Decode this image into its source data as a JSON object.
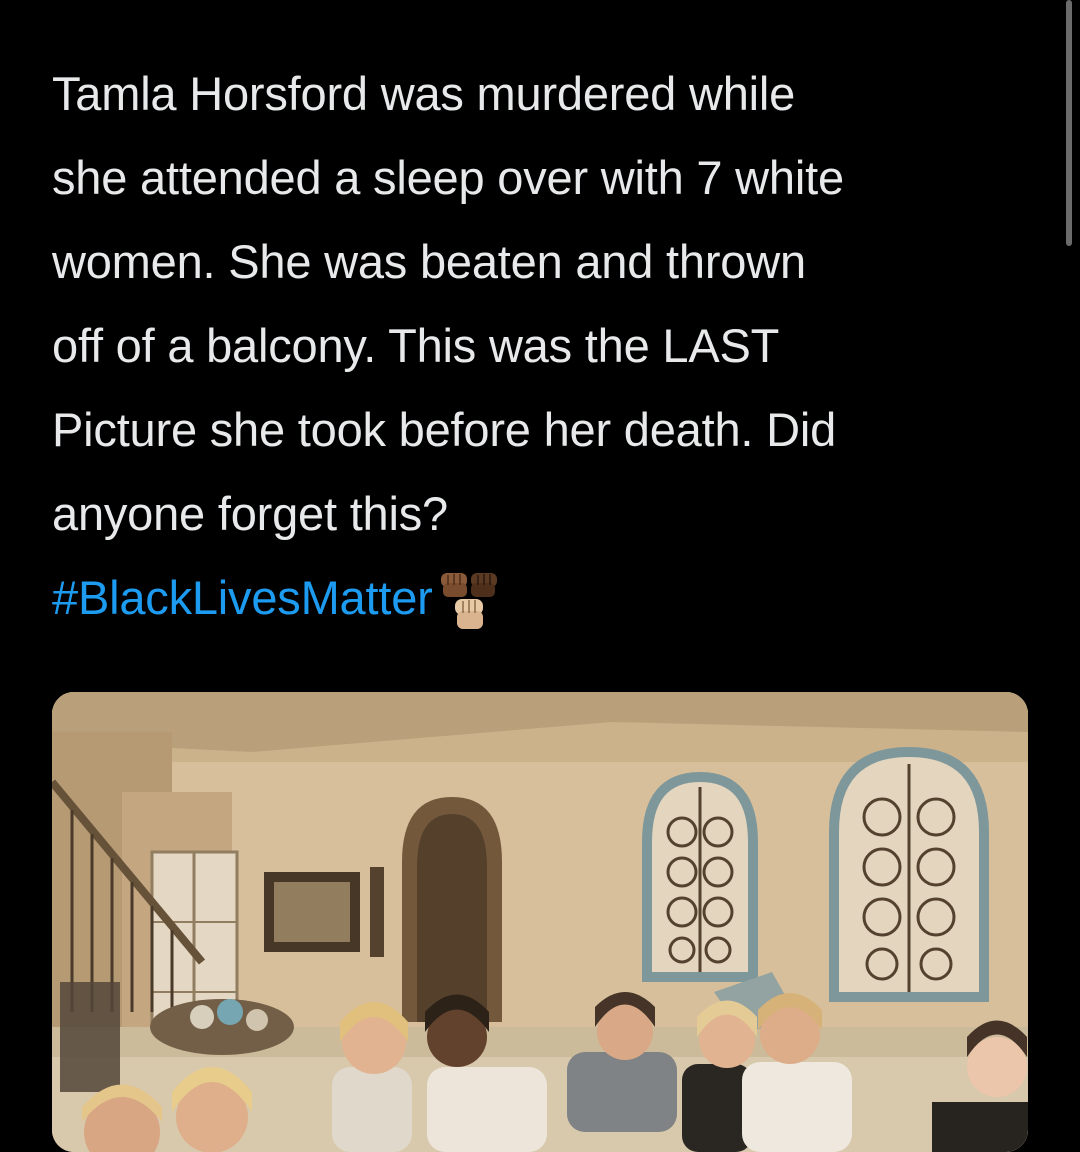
{
  "tweet": {
    "lines": [
      "Tamla Horsford was murdered while",
      "she attended a sleep over with 7 white",
      "women. She was beaten and thrown",
      "off of a balcony. This was the LAST",
      "Picture she took before her death. Did",
      "anyone forget this?"
    ],
    "hashtag": "#BlackLivesMatter",
    "emoji": "raised-fists-emoji",
    "colors": {
      "background": "#000000",
      "text": "#e7e9ea",
      "hashtag": "#1d9bf0"
    }
  },
  "media": {
    "type": "photo",
    "subject": "group-photo-living-room"
  }
}
